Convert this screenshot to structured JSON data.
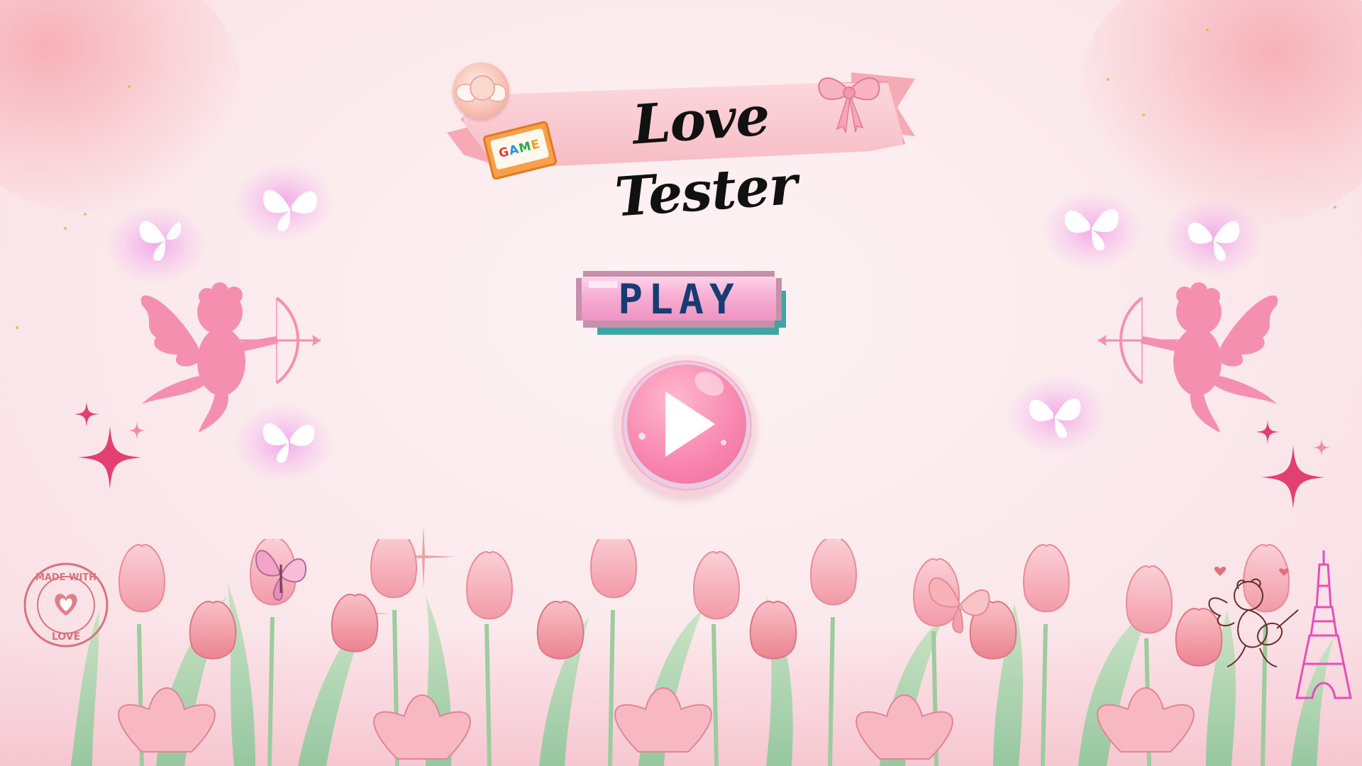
{
  "title": {
    "text": "Love Tester",
    "game_badge": "GAME",
    "game_badge_letters": [
      {
        "ch": "G",
        "color": "#e03a3a"
      },
      {
        "ch": "A",
        "color": "#2f8fd6"
      },
      {
        "ch": "M",
        "color": "#2caa4a"
      },
      {
        "ch": "E",
        "color": "#e6a21e"
      }
    ]
  },
  "buttons": {
    "play_label": "PLAY"
  },
  "stamp": {
    "top_text": "MADE WITH",
    "bottom_text": "LOVE"
  },
  "colors": {
    "background": "#fbe9ec",
    "cupid_pink": "#f58fb0",
    "play_text": "#173c73",
    "play_button": "#f785ad",
    "sparkle": "#e23f73"
  },
  "icons": {
    "cupid": "cupid-icon",
    "butterfly": "butterfly-icon",
    "sparkle": "sparkle-icon",
    "play": "play-triangle-icon",
    "eiffel_tower": "eiffel-tower-icon",
    "ribbon_bow": "bow-icon"
  }
}
